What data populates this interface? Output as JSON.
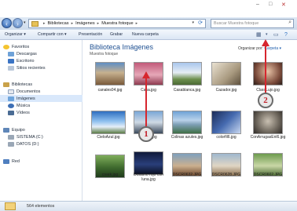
{
  "address": {
    "crumbs": [
      "Bibliotecas",
      "Imágenes",
      "Muestra fotoque"
    ],
    "search_placeholder": "Buscar Muestra fotoque"
  },
  "toolbar": {
    "organize": "Organizar ▾",
    "share": "Compartir con ▾",
    "slideshow": "Presentación",
    "burn": "Grabar",
    "new_folder": "Nueva carpeta"
  },
  "nav": {
    "favorites": "Favoritos",
    "downloads": "Descargas",
    "desktop": "Escritorio",
    "recent": "Sitios recientes",
    "libraries": "Bibliotecas",
    "documents": "Documentos",
    "images": "Imágenes",
    "music": "Música",
    "videos": "Vídeos",
    "computer": "Equipo",
    "drive_c": "SISTEMA (C:)",
    "drive_d": "DATOS (D:)",
    "network": "Red"
  },
  "main": {
    "title": "Biblioteca Imágenes",
    "subtitle": "Muestra fotoque",
    "arrange_label": "Organizar por:",
    "arrange_value": "Carpeta ▾"
  },
  "files": [
    {
      "name": "canales04.jpg"
    },
    {
      "name": "Casa.jpg"
    },
    {
      "name": "Casablanca.jpg"
    },
    {
      "name": "Cazador.jpg"
    },
    {
      "name": "ClaraLujo.jpg"
    },
    {
      "name": "CieloAzul.jpg"
    },
    {
      "name": "coche.jpg"
    },
    {
      "name": "Colinas azules.jpg"
    },
    {
      "name": "colorfil6.jpg"
    },
    {
      "name": "ConArrugasEnl6.jpg"
    },
    {
      "name": "creek.jpg"
    },
    {
      "name": "Dosamo rojo con luna.jpg"
    },
    {
      "name": "DSCR0632.JPG"
    },
    {
      "name": "DSCR0628.JPG"
    },
    {
      "name": "DSCR0602.JPG"
    }
  ],
  "status": {
    "count": "564 elementos"
  },
  "callouts": {
    "one": "1",
    "two": "2"
  },
  "colors": {
    "accent": "#1d4f91",
    "callout": "#d7262e"
  }
}
